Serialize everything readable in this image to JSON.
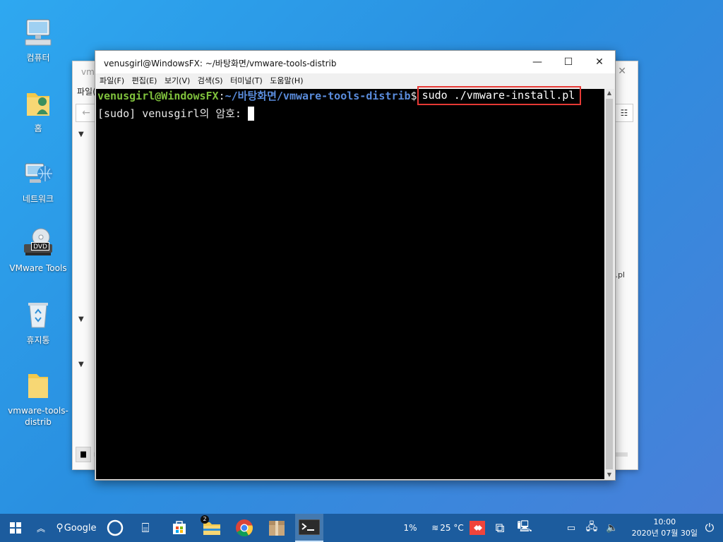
{
  "desktop": {
    "icons": [
      {
        "label": "컴퓨터",
        "icon": "computer-icon"
      },
      {
        "label": "홈",
        "icon": "home-folder-icon"
      },
      {
        "label": "네트워크",
        "icon": "network-icon"
      },
      {
        "label": "VMware Tools",
        "icon": "dvd-drive-icon",
        "badge": "DVD"
      },
      {
        "label": "휴지통",
        "icon": "recycle-bin-icon"
      },
      {
        "label": "vmware-tools-distrib",
        "icon": "folder-icon"
      }
    ]
  },
  "file_manager": {
    "title_partial": "vm",
    "menu_partial": "파일(",
    "file_partial": ".pl"
  },
  "terminal": {
    "title": "venusgirl@WindowsFX: ~/바탕화면/vmware-tools-distrib",
    "menu": [
      "파일(F)",
      "편집(E)",
      "보기(V)",
      "검색(S)",
      "터미널(T)",
      "도움말(H)"
    ],
    "prompt_user": "venusgirl@WindowsFX",
    "prompt_sep": ":",
    "prompt_path": "~/바탕화면/vmware-tools-distrib",
    "prompt_dollar": "$",
    "command": "sudo ./vmware-install.pl",
    "password_prompt": "[sudo] venusgirl의 암호: ",
    "highlight_color": "#e53935"
  },
  "taskbar": {
    "search_label": "Google",
    "file_manager_badge": "2",
    "cpu": "1%",
    "weather": "25 °C",
    "time": "10:00",
    "date": "2020년 07월 30일"
  }
}
